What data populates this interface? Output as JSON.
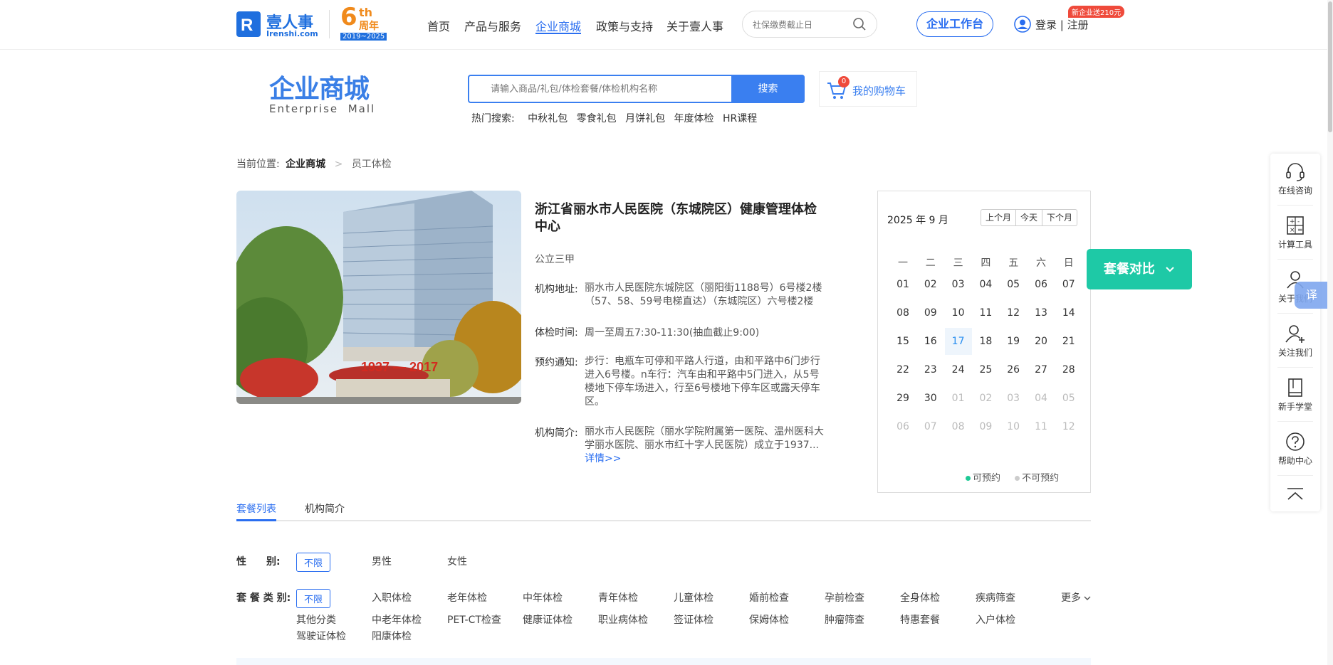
{
  "header": {
    "logo_cn": "壹人事",
    "logo_en": "Irenshi.com",
    "anniv_big": "6",
    "anniv_th": "th",
    "anniv_label": "周年",
    "anniv_years": "2019~2025",
    "nav": [
      "首页",
      "产品与服务",
      "企业商城",
      "政策与支持",
      "关于壹人事"
    ],
    "active_nav": 2,
    "search_placeholder": "社保缴费截止日",
    "workbench": "企业工作台",
    "login": "登录 | 注册",
    "promo_badge": "新企业送210元"
  },
  "mall": {
    "title_cn": "企业商城",
    "title_en": "Enterprise  Mall",
    "search_placeholder": "请输入商品/礼包/体检套餐/体检机构名称",
    "search_btn": "搜索",
    "cart_label": "我的购物车",
    "cart_count": "0",
    "hot_label": "热门搜索:",
    "hot": [
      "中秋礼包",
      "零食礼包",
      "月饼礼包",
      "年度体检",
      "HR课程"
    ]
  },
  "breadcrumb": {
    "label": "当前位置:",
    "level1": "企业商城",
    "sep": ">",
    "level2": "员工体检"
  },
  "institution": {
    "name_line1": "浙江省丽水市人民医院（东城院区）健康管理体检",
    "name_line2": "中心",
    "grade": "公立三甲",
    "addr_label": "机构地址:",
    "addr_l1": "丽水市人民医院东城院区（丽阳街1188号）6号楼2楼",
    "addr_l2": "（57、58、59号电梯直达）（东城院区）六号楼2楼",
    "time_label": "体检时间:",
    "time": "周一至周五7:30-11:30(抽血截止9:00)",
    "notice_label": "预约通知:",
    "notice_l1": "步行：电瓶车可停和平路人行道，由和平路中6门步行",
    "notice_l2": "进入6号楼。n车行：汽车由和平路中5门进入，从5号",
    "notice_l3": "楼地下停车场进入，行至6号楼地下停车区或露天停车",
    "notice_l4": "区。",
    "intro_label": "机构简介:",
    "intro_l1": "丽水市人民医院（丽水学院附属第一医院、温州医科大",
    "intro_l2": "学丽水医院、丽水市红十字人民医院）成立于1937...",
    "more": "详情>>",
    "photo_banner": "1937 — 2017"
  },
  "calendar": {
    "month_label": "2025 年 9 月",
    "prev": "上个月",
    "today_btn": "今天",
    "next": "下个月",
    "weekdays": [
      "一",
      "二",
      "三",
      "四",
      "五",
      "六",
      "日"
    ],
    "days": [
      "01",
      "02",
      "03",
      "04",
      "05",
      "06",
      "07",
      "08",
      "09",
      "10",
      "11",
      "12",
      "13",
      "14",
      "15",
      "16",
      "17",
      "18",
      "19",
      "20",
      "21",
      "22",
      "23",
      "24",
      "25",
      "26",
      "27",
      "28",
      "29",
      "30",
      "01",
      "02",
      "03",
      "04",
      "05",
      "06",
      "07",
      "08",
      "09",
      "10",
      "11",
      "12"
    ],
    "today_index": 16,
    "current_month_count": 30,
    "legend_available": "可预约",
    "legend_unavailable": "不可预约",
    "legend_available_color": "#1ec995",
    "legend_unavailable_color": "#cccccc"
  },
  "compare_btn": "套餐对比",
  "tabs": [
    "套餐列表",
    "机构简介"
  ],
  "filters": {
    "gender_label": "性　　别:",
    "gender_opts": [
      "不限",
      "男性",
      "女性"
    ],
    "type_label": "套 餐 类 别:",
    "type_row1": [
      "不限",
      "入职体检",
      "老年体检",
      "中年体检",
      "青年体检",
      "儿童体检",
      "婚前检查",
      "孕前检查",
      "全身体检",
      "疾病筛查"
    ],
    "type_row2": [
      "其他分类",
      "中老年体检",
      "PET-CT检查",
      "健康证体检",
      "职业病体检",
      "签证体检",
      "保姆体检",
      "肿瘤筛查",
      "特惠套餐",
      "入户体检"
    ],
    "type_row3": [
      "驾驶证体检",
      "阳康体检"
    ],
    "more": "更多"
  },
  "sidebar": {
    "items": [
      "在线咨询",
      "计算工具",
      "关于我们",
      "关注我们",
      "新手学堂",
      "帮助中心"
    ],
    "translate": "译"
  },
  "colors": {
    "brand": "#2a6ef0",
    "teal": "#1ec9a6",
    "orange": "#f08a1c",
    "badge": "#ef4a3b"
  }
}
